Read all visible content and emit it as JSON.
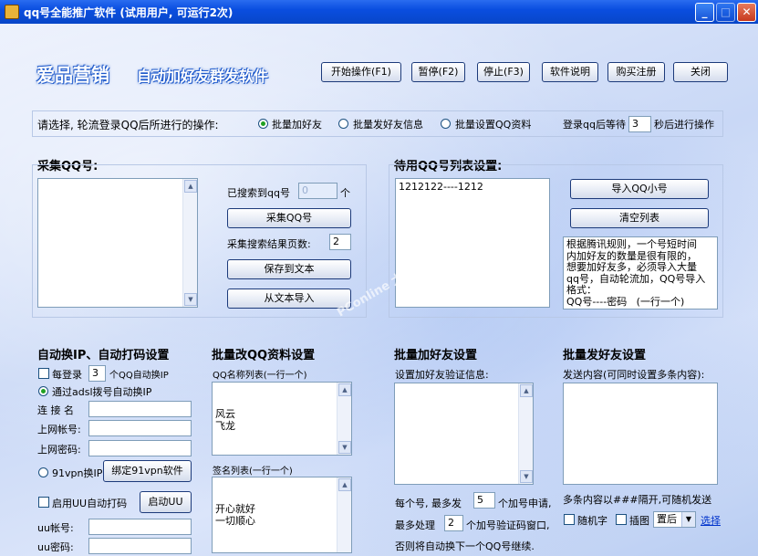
{
  "window": {
    "title": "qq号全能推广软件  (试用用户, 可运行2次)"
  },
  "header": {
    "brand": "爱品营销",
    "subtitle": "自动加好友群发软件",
    "buttons": [
      "开始操作(F1)",
      "暂停(F2)",
      "停止(F3)",
      "软件说明",
      "购买注册",
      "关闭"
    ]
  },
  "mode_bar": {
    "prompt": "请选择, 轮流登录QQ后所进行的操作:",
    "options": [
      "批量加好友",
      "批量发好友信息",
      "批量设置QQ资料"
    ],
    "selected": "批量加好友",
    "wait_prefix": "登录qq后等待",
    "wait_value": "3",
    "wait_suffix": "秒后进行操作"
  },
  "collect": {
    "title": "采集QQ号:",
    "searched_label": "已搜索到qq号",
    "searched_value": "0",
    "searched_unit": "个",
    "collect_btn": "采集QQ号",
    "pages_label": "采集搜索结果页数:",
    "pages_value": "2",
    "save_btn": "保存到文本",
    "import_btn": "从文本导入"
  },
  "pending": {
    "title": "待用QQ号列表设置:",
    "list": "1212122----1212",
    "import_btn": "导入QQ小号",
    "clear_btn": "清空列表",
    "notes": "根据腾讯规则，一个号短时间\n内加好友的数量是很有限的，\n想要加好友多，必须导入大量\nqq号，自动轮流加，QQ号导入\n格式：\nQQ号----密码   (一行一个)"
  },
  "ipchange": {
    "title": "自动换IP、自动打码设置",
    "every_label": "每登录",
    "every_value": "3",
    "every_suffix": "个QQ自动换IP",
    "adsl_label": "通过adsl拨号自动换IP",
    "conn_label": "连 接 名",
    "account_label": "上网帐号:",
    "password_label": "上网密码:",
    "vpn_label": "91vpn换IP",
    "vpn_btn": "绑定91vpn软件",
    "uu_enable_label": "启用UU自动打码",
    "uu_start_btn": "启动UU",
    "uu_account_label": "uu帐号:",
    "uu_password_label": "uu密码:"
  },
  "profile": {
    "title": "批量改QQ资料设置",
    "names_label": "QQ名称列表(一行一个)",
    "names_list": "风云\n飞龙",
    "sign_label": "签名列表(一行一个)",
    "sign_list": "开心就好\n一切顺心"
  },
  "addfriend": {
    "title": "批量加好友设置",
    "verify_label": "设置加好友验证信息:",
    "per_qq_prefix": "每个号, 最多发",
    "per_qq_value": "5",
    "per_qq_suffix": "个加号申请,",
    "max_code_prefix": "最多处理",
    "max_code_value": "2",
    "max_code_suffix": "个加号验证码窗口,",
    "footer": "否则将自动换下一个QQ号继续."
  },
  "sendmsg": {
    "title": "批量发好友设置",
    "content_label": "发送内容(可同时设置多条内容):",
    "hint": "多条内容以###隔开,可随机发送",
    "random_label": "随机字",
    "image_label": "插图",
    "position_value": "置后",
    "select_link": "选择"
  },
  "watermark": "PConline 太平洋电脑网"
}
